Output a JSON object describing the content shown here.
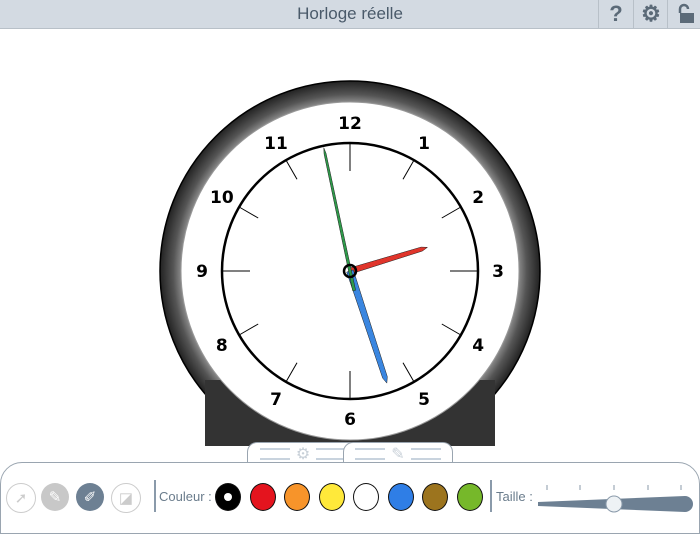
{
  "header": {
    "title": "Horloge réelle",
    "help_icon": "?",
    "settings_icon": "gear-icon",
    "lock_icon": "unlock-icon"
  },
  "clock": {
    "numbers": [
      "12",
      "1",
      "2",
      "3",
      "4",
      "5",
      "6",
      "7",
      "8",
      "9",
      "10",
      "11"
    ],
    "time": {
      "hours": 2,
      "minutes": 26,
      "seconds": 58
    },
    "colors": {
      "hour": "#e0352b",
      "minute": "#3a86e0",
      "second": "#2e9a4a"
    }
  },
  "toolbar": {
    "tools": [
      "pointer",
      "pencil",
      "marker",
      "eraser"
    ],
    "color_label": "Couleur :",
    "colors": [
      "#000000",
      "#e4141e",
      "#f7942a",
      "#ffe93a",
      "#ffffff",
      "#2f7ee6",
      "#9c741e",
      "#76b82a"
    ],
    "size_label": "Taille :",
    "size_value": 0.5
  }
}
